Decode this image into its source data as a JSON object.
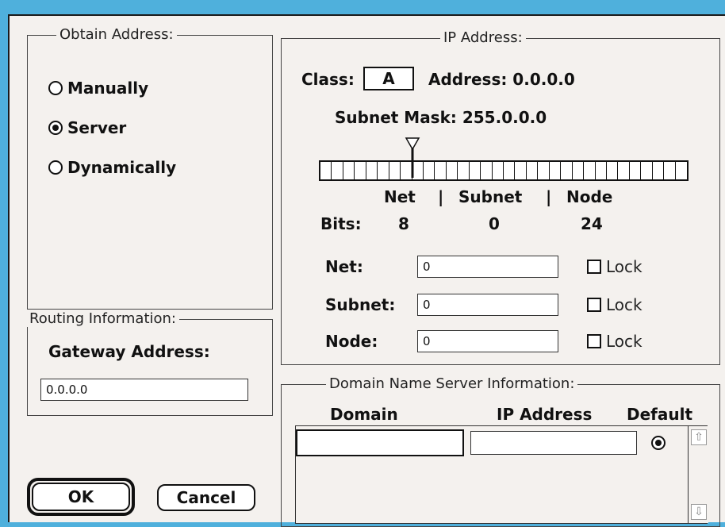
{
  "obtain": {
    "legend": "Obtain Address:",
    "options": [
      {
        "label": "Manually",
        "selected": false
      },
      {
        "label": "Server",
        "selected": true
      },
      {
        "label": "Dynamically",
        "selected": false
      }
    ]
  },
  "routing": {
    "legend": "Routing Information:",
    "gateway_label": "Gateway Address:",
    "gateway_value": "0.0.0.0"
  },
  "buttons": {
    "ok": "OK",
    "cancel": "Cancel"
  },
  "ip": {
    "legend": "IP Address:",
    "class_label": "Class:",
    "class_value": "A",
    "address_text": "Address: 0.0.0.0",
    "subnet_mask_text": "Subnet Mask: 255.0.0.0",
    "bit_cells": 32,
    "slider_position_bits": 8,
    "headers": {
      "net": "Net",
      "subnet": "Subnet",
      "node": "Node",
      "sep": "|"
    },
    "bits_label": "Bits:",
    "bits": {
      "net": "8",
      "subnet": "0",
      "node": "24"
    },
    "rows": [
      {
        "label": "Net:",
        "value": "0",
        "lock": "Lock",
        "locked": false
      },
      {
        "label": "Subnet:",
        "value": "0",
        "lock": "Lock",
        "locked": false
      },
      {
        "label": "Node:",
        "value": "0",
        "lock": "Lock",
        "locked": false
      }
    ]
  },
  "dns": {
    "legend": "Domain Name Server Information:",
    "columns": {
      "domain": "Domain",
      "ip": "IP Address",
      "default": "Default"
    },
    "row": {
      "domain": "",
      "ip": "",
      "default": true
    }
  },
  "icons": {
    "scroll_up": "scroll-up-arrow-icon",
    "scroll_down": "scroll-down-arrow-icon"
  }
}
